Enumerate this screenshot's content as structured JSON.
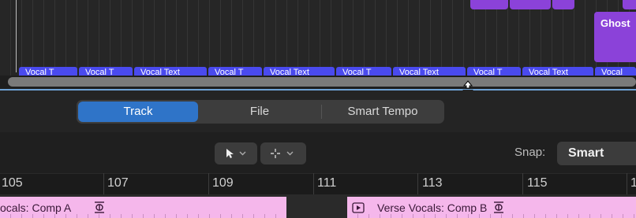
{
  "arrange": {
    "ghost_region_label": "Ghost",
    "vocal_regions": [
      "Vocal T",
      "Vocal T",
      "Vocal Text",
      "Vocal T",
      "Vocal Text",
      "Vocal T",
      "Vocal Text",
      "Vocal T",
      "Vocal Text",
      "Vocal"
    ]
  },
  "tabs": {
    "track": "Track",
    "file": "File",
    "smart_tempo": "Smart Tempo"
  },
  "toolbar": {
    "pointer_tool_icon": "arrow-pointer-icon",
    "secondary_tool_icon": "crosshair-icon",
    "snap_label": "Snap:",
    "snap_value": "Smart"
  },
  "ruler": {
    "bars": [
      "105",
      "107",
      "109",
      "111",
      "113",
      "115",
      "1"
    ]
  },
  "regions": {
    "comp_a": "ocals: Comp A",
    "comp_b": "Verse Vocals: Comp B"
  },
  "colors": {
    "accent_blue": "#2f74c8",
    "vocal_region": "#4a4aee",
    "ghost_region": "#8b42d9",
    "comp_region": "#f5b7eb"
  }
}
